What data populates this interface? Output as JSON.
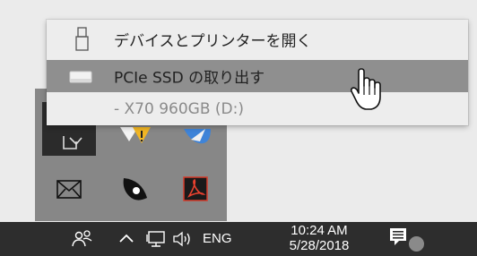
{
  "context_menu": {
    "items": [
      {
        "label": "デバイスとプリンターを開く",
        "icon": "usb-drive-icon",
        "highlighted": false
      },
      {
        "label": "PCIe SSD の取り出す",
        "icon": "ssd-drive-icon",
        "highlighted": true
      },
      {
        "label": "- X70 960GB (D:)",
        "icon": null,
        "highlighted": false
      }
    ]
  },
  "tray_overflow": {
    "icons": [
      "safely-remove-hardware-icon",
      "network-warning-icon",
      "dropbox-icon",
      "mail-icon",
      "media-player-icon",
      "adobe-acrobat-icon"
    ]
  },
  "taskbar": {
    "icons": [
      "people-icon",
      "show-hidden-icons-chevron",
      "network-icon",
      "volume-icon",
      "action-center-icon"
    ],
    "language": "ENG",
    "clock": {
      "time": "10:24 AM",
      "date": "5/28/2018"
    }
  },
  "colors": {
    "menu_background": "#ededed",
    "menu_highlight": "#8f8f8f",
    "taskbar": "#2d2d2d",
    "tray_overflow": "#878787"
  }
}
